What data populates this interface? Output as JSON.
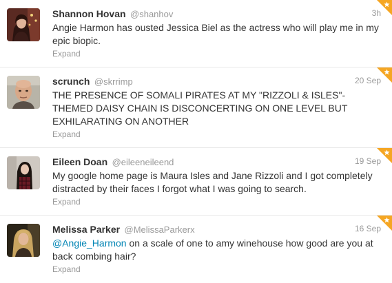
{
  "colors": {
    "favorite_badge": "#f5a623",
    "username": "#999999",
    "mention_link": "#0084b4",
    "divider": "#e8e8e8"
  },
  "tweets": [
    {
      "fullname": "Shannon Hovan",
      "username": "@shanhov",
      "time": "3h",
      "text": "Angie Harmon has ousted Jessica Biel as the actress who will play me in my epic biopic.",
      "expand": "Expand",
      "favorited": true,
      "avatar": "avatar-photo-woman-holiday"
    },
    {
      "fullname": "scrunch",
      "username": "@skrrimp",
      "time": "20 Sep",
      "text": "THE PRESENCE OF SOMALI PIRATES AT MY \"RIZZOLI & ISLES\"-THEMED DAISY CHAIN IS DISCONCERTING ON ONE LEVEL BUT EXHILARATING ON ANOTHER",
      "expand": "Expand",
      "favorited": true,
      "avatar": "avatar-photo-bald-man"
    },
    {
      "fullname": "Eileen Doan",
      "username": "@eileeneileend",
      "time": "19 Sep",
      "text": "My google home page is Maura Isles and Jane Rizzoli and I got completely distracted by their faces I forgot what I was going to search.",
      "expand": "Expand",
      "favorited": true,
      "avatar": "avatar-photo-woman-plaid"
    },
    {
      "fullname": "Melissa Parker",
      "username": "@MelissaParkerx",
      "time": "16 Sep",
      "mention": "@Angie_Harmon",
      "text": " on a scale of one to amy winehouse how good are you at back combing hair?",
      "expand": "Expand",
      "favorited": true,
      "avatar": "avatar-photo-woman-blonde"
    }
  ]
}
